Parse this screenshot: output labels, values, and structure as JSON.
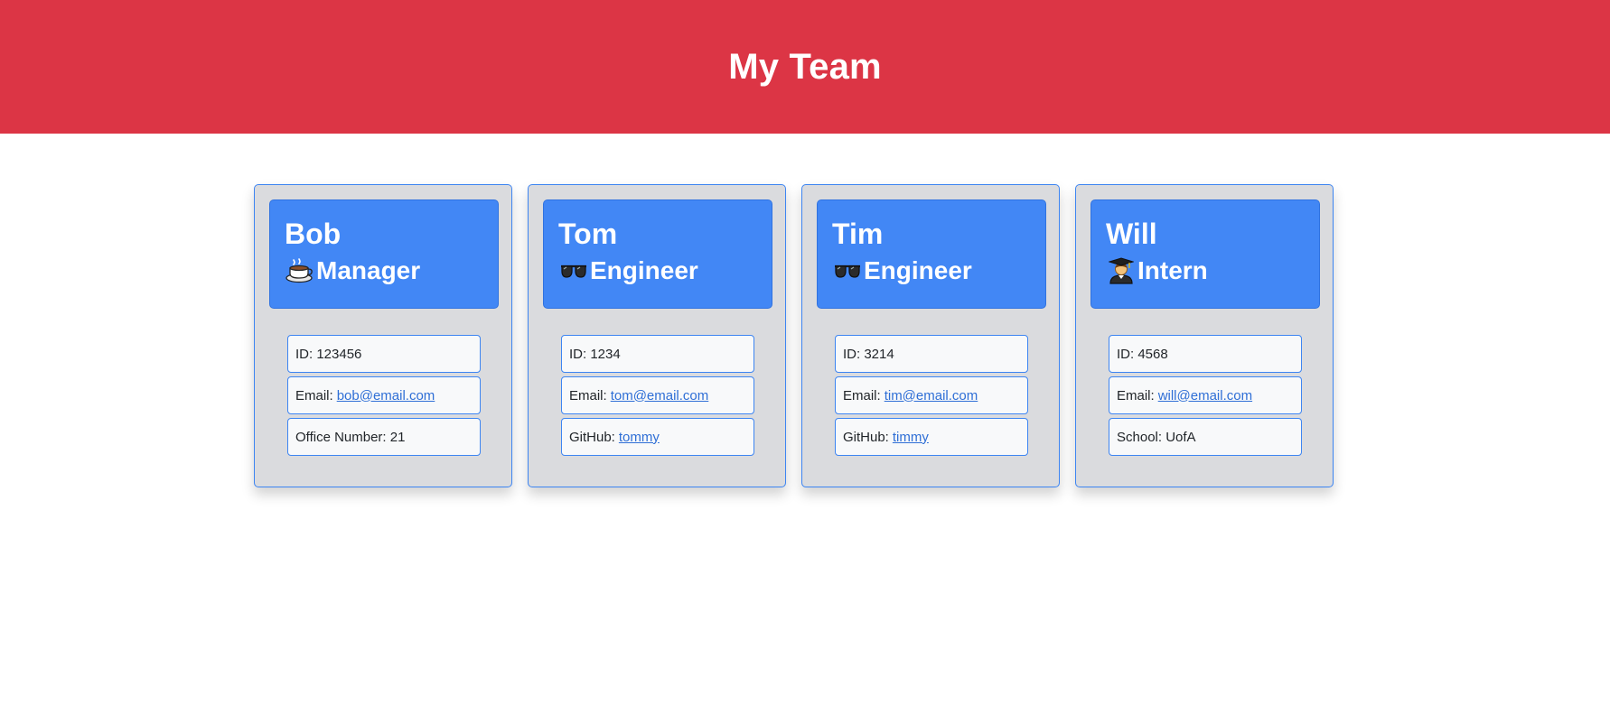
{
  "header": {
    "title": "My Team"
  },
  "colors": {
    "header_bg": "#dc3545",
    "card_head_bg": "#4287f5",
    "card_bg": "#dadbde",
    "border": "#3d85f2"
  },
  "cards": [
    {
      "name": "Bob",
      "role": "Manager",
      "icon": "coffee-cup-icon",
      "id_label": "ID:",
      "id_value": "123456",
      "email_label": "Email:",
      "email_value": "bob@email.com",
      "extra_label": "Office Number:",
      "extra_value": "21"
    },
    {
      "name": "Tom",
      "role": "Engineer",
      "icon": "glasses-icon",
      "id_label": "ID:",
      "id_value": "1234",
      "email_label": "Email:",
      "email_value": "tom@email.com",
      "extra_label": "GitHub:",
      "extra_value": "tommy"
    },
    {
      "name": "Tim",
      "role": "Engineer",
      "icon": "glasses-icon",
      "id_label": "ID:",
      "id_value": "3214",
      "email_label": "Email:",
      "email_value": "tim@email.com",
      "extra_label": "GitHub:",
      "extra_value": "timmy"
    },
    {
      "name": "Will",
      "role": "Intern",
      "icon": "graduate-icon",
      "id_label": "ID:",
      "id_value": "4568",
      "email_label": "Email:",
      "email_value": "will@email.com",
      "extra_label": "School:",
      "extra_value": "UofA"
    }
  ]
}
